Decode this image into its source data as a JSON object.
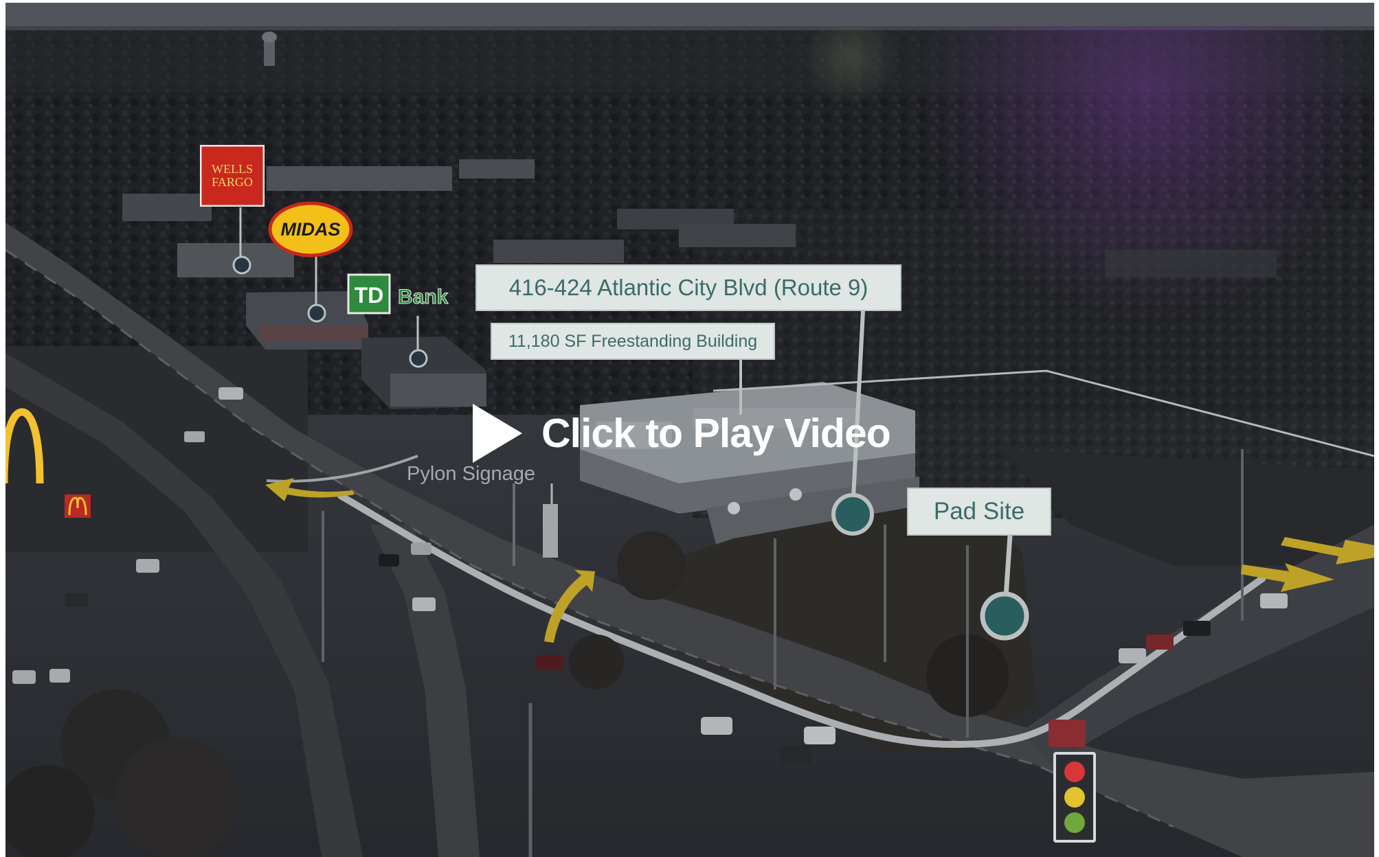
{
  "player": {
    "play_label": "Click to Play Video"
  },
  "annotations": {
    "address": "416-424 Atlantic City Blvd (Route 9)",
    "building": "11,180 SF Freestanding Building",
    "pad_site": "Pad Site",
    "pylon": "Pylon Signage"
  },
  "logos": {
    "wells_fargo": "WELLS\nFARGO",
    "midas": "MIDAS",
    "td_mark": "TD",
    "td_bank": "Bank"
  },
  "colors": {
    "callout_fill": "#dfe6e4",
    "callout_text": "#3c6b6a",
    "marker": "#2f6d6d",
    "arrow_yellow": "#e3c12a",
    "wells_red": "#c8281e",
    "midas_yellow": "#f3c019",
    "td_green": "#2e8a3c"
  }
}
